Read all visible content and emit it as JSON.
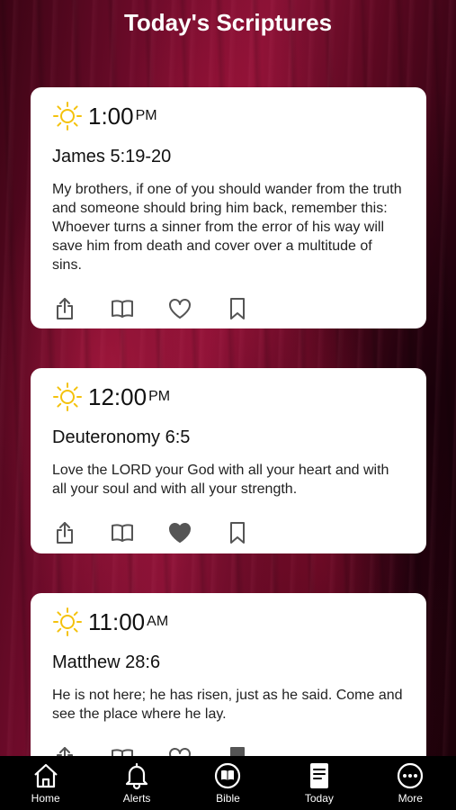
{
  "header": {
    "title": "Today's Scriptures"
  },
  "colors": {
    "sun": "#f4c20d",
    "card_bg": "#ffffff",
    "icon": "#555555",
    "tabbar_bg": "#000000"
  },
  "cards": [
    {
      "icon": "sun-icon",
      "time": "1:00",
      "ampm": "PM",
      "reference": "James 5:19-20",
      "verse": "My brothers, if one of you should wander from the truth and someone should bring him back, remember this: Whoever turns a sinner from the error of his way will save him from death and cover over a multitude of sins.",
      "favorited": false
    },
    {
      "icon": "sun-icon",
      "time": "12:00",
      "ampm": "PM",
      "reference": "Deuteronomy 6:5",
      "verse": "Love the LORD your God with all your heart and with all your soul and with all your strength.",
      "favorited": true
    },
    {
      "icon": "sun-icon",
      "time": "11:00",
      "ampm": "AM",
      "reference": "Matthew 28:6",
      "verse": "He is not here; he has risen, just as he said. Come and see the place where he lay.",
      "favorited": false
    }
  ],
  "tabbar": {
    "items": [
      {
        "label": "Home",
        "icon": "home-icon"
      },
      {
        "label": "Alerts",
        "icon": "bell-icon"
      },
      {
        "label": "Bible",
        "icon": "bible-icon"
      },
      {
        "label": "Today",
        "icon": "document-icon"
      },
      {
        "label": "More",
        "icon": "more-icon"
      }
    ]
  }
}
